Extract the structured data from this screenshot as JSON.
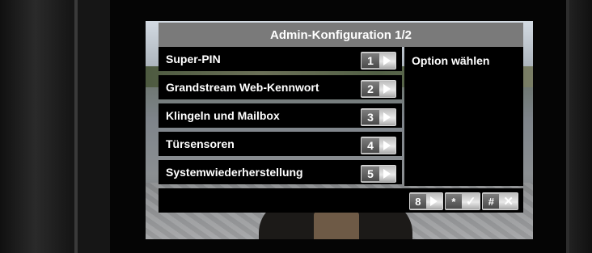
{
  "menu": {
    "title": "Admin-Konfiguration 1/2",
    "hint": "Option wählen",
    "items": [
      {
        "label": "Super-PIN",
        "key": "1"
      },
      {
        "label": "Grandstream Web-Kennwort",
        "key": "2"
      },
      {
        "label": "Klingeln und Mailbox",
        "key": "3"
      },
      {
        "label": "Türsensoren",
        "key": "4"
      },
      {
        "label": "Systemwiederherstellung",
        "key": "5"
      }
    ]
  },
  "footer": {
    "next_key": "8",
    "confirm_key": "*",
    "cancel_key": "#"
  },
  "icons": {
    "arrow": "play-arrow-icon",
    "confirm": "checkmark-icon",
    "cancel": "cross-icon"
  },
  "colors": {
    "title_bar": "#7a7a7a",
    "panel": "#000000",
    "text": "#ffffff"
  }
}
